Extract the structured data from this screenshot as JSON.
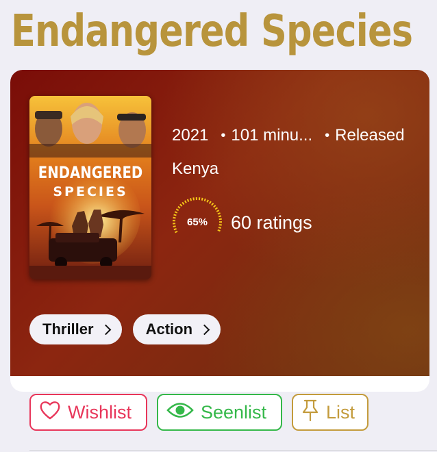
{
  "title": "Endangered Species",
  "poster": {
    "title_line1": "ENDANGERED",
    "title_line2": "SPECIES"
  },
  "meta": {
    "year": "2021",
    "runtime": "101 minu...",
    "status": "Released",
    "country": "Kenya"
  },
  "rating": {
    "percent_label": "65%",
    "percent": 65,
    "count_label": "60 ratings"
  },
  "genres": [
    {
      "label": "Thriller"
    },
    {
      "label": "Action"
    }
  ],
  "actions": {
    "wishlist": "Wishlist",
    "seenlist": "Seenlist",
    "list": "List"
  },
  "colors": {
    "title": "#b8943c",
    "wishlist": "#e8365a",
    "seenlist": "#35b84a",
    "list": "#c39b3c",
    "rating_ring": "#f5c518"
  }
}
